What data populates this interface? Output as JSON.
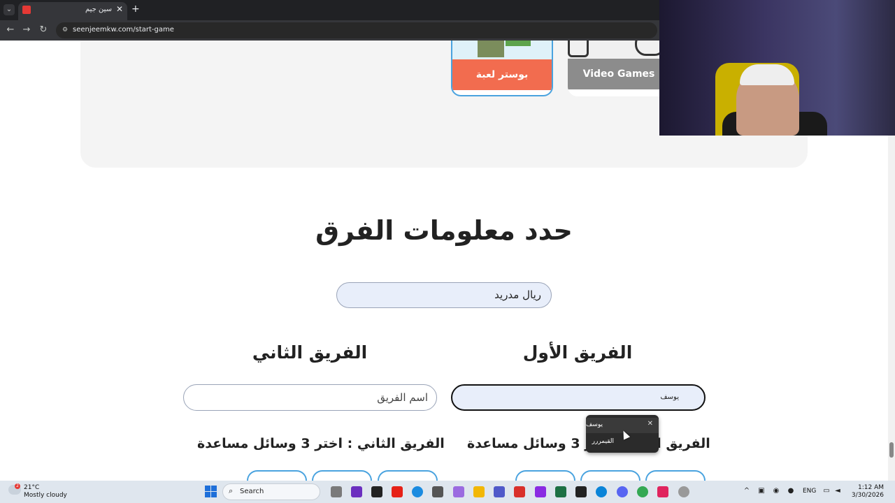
{
  "browser": {
    "tab_title": "سين جيم",
    "url": "seenjeemkw.com/start-game",
    "icons": {
      "tab_search": "chevron-down-icon",
      "close": "close-icon",
      "new_tab": "plus-icon",
      "back": "arrow-left-icon",
      "forward": "arrow-right-icon",
      "reload": "reload-icon",
      "site_info": "tune-icon"
    }
  },
  "categories": [
    {
      "label": "بوستر لعبة",
      "color": "#f26c4f"
    },
    {
      "label": "Video Games",
      "color": "#8c8c8c"
    }
  ],
  "main": {
    "section_title": "حدد معلومات الفرق",
    "game_name_value": "ريال مدريد",
    "team1": {
      "title": "الفريق الأول",
      "input_value": "يوسف",
      "aids_title": "الفريق الأول : اختر 3 وسائل مساعدة"
    },
    "team2": {
      "title": "الفريق الثاني",
      "input_placeholder": "اسم الفريق",
      "aids_title": "الفريق الثاني : اختر 3 وسائل مساعدة"
    }
  },
  "autocomplete": {
    "items": [
      "يوسف",
      "القيمررر"
    ]
  },
  "taskbar": {
    "weather_temp": "21°C",
    "weather_desc": "Mostly cloudy",
    "weather_badge": "2",
    "search_label": "Search",
    "language": "ENG",
    "time": "1:12 AM",
    "date": "3/30/2026"
  },
  "colors": {
    "accent_blue": "#4aa3df",
    "poster_orange": "#f26c4f",
    "video_gray": "#8c8c8c"
  }
}
